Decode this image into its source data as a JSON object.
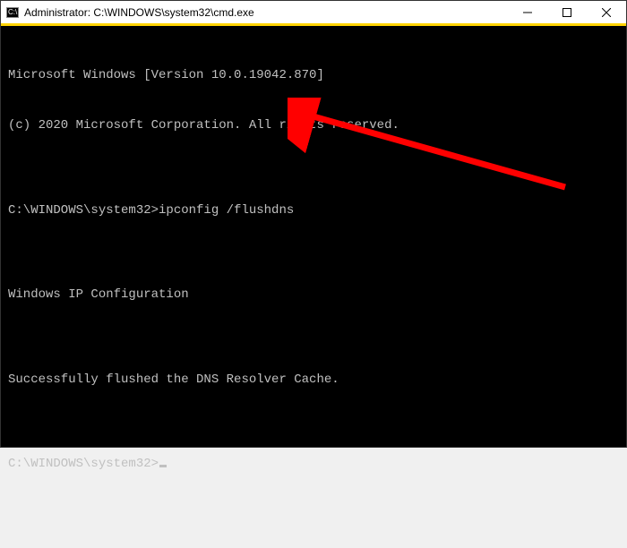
{
  "titlebar": {
    "icon_label": "C:\\",
    "title": "Administrator: C:\\WINDOWS\\system32\\cmd.exe"
  },
  "terminal": {
    "lines": [
      "Microsoft Windows [Version 10.0.19042.870]",
      "(c) 2020 Microsoft Corporation. All rights reserved.",
      "",
      "C:\\WINDOWS\\system32>ipconfig /flushdns",
      "",
      "Windows IP Configuration",
      "",
      "Successfully flushed the DNS Resolver Cache.",
      "",
      "C:\\WINDOWS\\system32>"
    ],
    "prompt": "C:\\WINDOWS\\system32>",
    "command": "ipconfig /flushdns",
    "header_version": "Microsoft Windows [Version 10.0.19042.870]",
    "header_copyright": "(c) 2020 Microsoft Corporation. All rights reserved.",
    "config_heading": "Windows IP Configuration",
    "result_message": "Successfully flushed the DNS Resolver Cache."
  },
  "annotation": {
    "arrow_color": "#ff0000"
  }
}
